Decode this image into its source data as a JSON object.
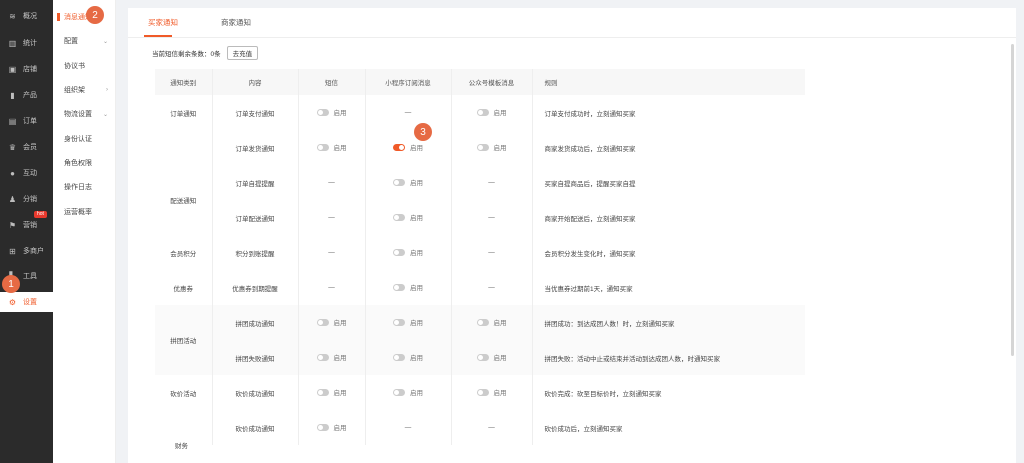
{
  "nav": {
    "items": [
      {
        "label": "概况",
        "icon": "layers-icon"
      },
      {
        "label": "统计",
        "icon": "chart-icon"
      },
      {
        "label": "店铺",
        "icon": "store-icon"
      },
      {
        "label": "产品",
        "icon": "product-icon"
      },
      {
        "label": "订单",
        "icon": "order-icon"
      },
      {
        "label": "会员",
        "icon": "crown-icon"
      },
      {
        "label": "互动",
        "icon": "chat-icon"
      },
      {
        "label": "分销",
        "icon": "share-icon"
      },
      {
        "label": "营销",
        "icon": "flag-icon"
      },
      {
        "label": "多商户",
        "icon": "merchant-icon"
      },
      {
        "label": "工具",
        "icon": "tools-icon"
      },
      {
        "label": "设置",
        "icon": "settings-icon"
      }
    ],
    "hot_badge": "hot"
  },
  "submenu": {
    "items": [
      {
        "label": "消息通知",
        "chevron": ""
      },
      {
        "label": "配置",
        "chevron": "⌄"
      },
      {
        "label": "协议书",
        "chevron": ""
      },
      {
        "label": "组织架",
        "chevron": "›"
      },
      {
        "label": "物流设置",
        "chevron": "⌄"
      },
      {
        "label": "身份认证",
        "chevron": ""
      },
      {
        "label": "角色权限",
        "chevron": ""
      },
      {
        "label": "操作日志",
        "chevron": ""
      },
      {
        "label": "运营概率",
        "chevron": ""
      }
    ]
  },
  "tabs": [
    "买家通知",
    "商家通知"
  ],
  "toolbar": {
    "label": "当前短信剩余条数：0条",
    "button": "去充值"
  },
  "table": {
    "headers": [
      "通知类别",
      "内容",
      "短信",
      "小程序订阅消息",
      "公众号模板消息",
      "规则"
    ],
    "rows": [
      {
        "category": "订单通知",
        "content": "订单支付通知",
        "sms": "off",
        "mini": "dash",
        "official": "off",
        "rule": "订单支付成功时，立刻通知买家"
      },
      {
        "category": "",
        "content": "订单发货通知",
        "sms": "off",
        "mini": "on",
        "official": "off",
        "rule": "商家发货成功后，立刻通知买家"
      },
      {
        "category": "配送通知",
        "content": "订单自提提醒",
        "sms": "dash",
        "mini": "off",
        "official": "dash",
        "rule": "买家自提商品后，提醒买家自提"
      },
      {
        "category": "",
        "content": "订单配送通知",
        "sms": "dash",
        "mini": "off",
        "official": "dash",
        "rule": "商家开始配送后，立刻通知买家"
      },
      {
        "category": "会员积分",
        "content": "积分到账提醒",
        "sms": "dash",
        "mini": "off",
        "official": "dash",
        "rule": "会员积分发生变化时，通知买家"
      },
      {
        "category": "优惠券",
        "content": "优惠券到期提醒",
        "sms": "dash",
        "mini": "off",
        "official": "dash",
        "rule": "当优惠券过期前1天，通知买家"
      },
      {
        "category": "拼团活动",
        "content": "拼团成功通知",
        "sms": "off",
        "mini": "off",
        "official": "off",
        "rule": "拼团成功：到达成团人数！时，立刻通知买家"
      },
      {
        "category": "",
        "content": "拼团失败通知",
        "sms": "off",
        "mini": "off",
        "official": "off",
        "rule": "拼团失败：活动中止或结束并活动到达成团人数，时通知买家"
      },
      {
        "category": "砍价活动",
        "content": "砍价成功通知",
        "sms": "off",
        "mini": "off",
        "official": "off",
        "rule": "砍价完成：砍至目标价时，立刻通知买家"
      },
      {
        "category": "",
        "content": "砍价成功通知",
        "sms": "off",
        "mini": "dash",
        "official": "dash",
        "rule": "砍价成功后，立刻通知买家"
      }
    ],
    "last_category": "财务",
    "switch_label": "启用",
    "dash": "—"
  },
  "colors": {
    "accent": "#f05a28",
    "sidebar": "#2b2b2b",
    "callout": "#e66a44"
  },
  "callouts": [
    "1",
    "2",
    "3"
  ]
}
